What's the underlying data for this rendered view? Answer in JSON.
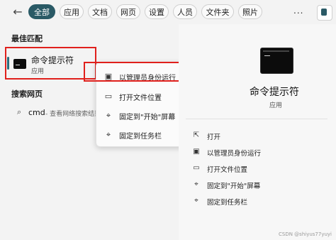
{
  "tabs": [
    {
      "label": "全部",
      "active": true
    },
    {
      "label": "应用"
    },
    {
      "label": "文档"
    },
    {
      "label": "网页"
    },
    {
      "label": "设置"
    },
    {
      "label": "人员"
    },
    {
      "label": "文件夹"
    },
    {
      "label": "照片"
    }
  ],
  "more_label": "...",
  "best_match": {
    "heading": "最佳匹配",
    "title": "命令提示符",
    "subtitle": "应用"
  },
  "web_search": {
    "heading": "搜索网页",
    "query": "cmd",
    "suffix": "- 查看网络搜索结果"
  },
  "context_menu": [
    {
      "label": "以管理员身份运行",
      "icon": "admin-shield-icon"
    },
    {
      "label": "打开文件位置",
      "icon": "folder-icon"
    },
    {
      "label": "固定到\"开始\"屏幕",
      "icon": "pin-icon"
    },
    {
      "label": "固定到任务栏",
      "icon": "pin-icon"
    }
  ],
  "detail_panel": {
    "title": "命令提示符",
    "subtitle": "应用",
    "actions": [
      {
        "label": "打开",
        "icon": "open-icon"
      },
      {
        "label": "以管理员身份运行",
        "icon": "admin-shield-icon"
      },
      {
        "label": "打开文件位置",
        "icon": "folder-icon"
      },
      {
        "label": "固定到\"开始\"屏幕",
        "icon": "pin-icon"
      },
      {
        "label": "固定到任务栏",
        "icon": "pin-icon"
      }
    ]
  },
  "watermark": "CSDN @shiyus77yuyi",
  "colors": {
    "accent": "#2a5a66",
    "highlight_red": "#e0201c"
  }
}
